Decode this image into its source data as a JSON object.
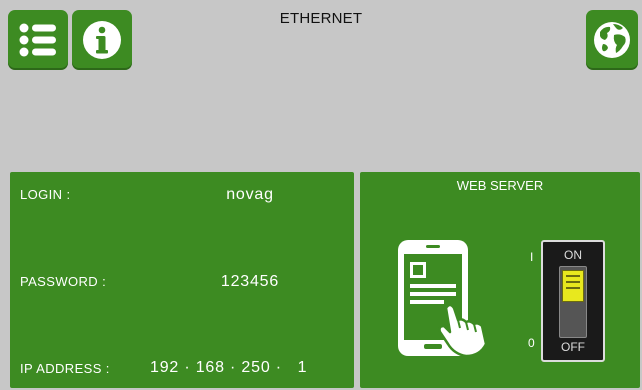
{
  "header": {
    "title": "ETHERNET",
    "menu_icon": "list-icon",
    "info_icon": "info-icon",
    "network_icon": "globe-icon"
  },
  "credentials": {
    "login_label": "LOGIN :",
    "login_value": "novag",
    "password_label": "PASSWORD :",
    "password_value": "123456",
    "ip_label": "IP ADDRESS :",
    "ip_value": "192 · 168 · 250 ·   1"
  },
  "web_server": {
    "title": "WEB SERVER",
    "icon": "phone-touch-icon",
    "switch_top_mark": "I",
    "switch_bottom_mark": "0",
    "switch_on_label": "ON",
    "switch_off_label": "OFF",
    "state": "ON"
  },
  "colors": {
    "background": "#c7c7c7",
    "panel": "#3d8b22",
    "switch_lever": "#e8e81e"
  }
}
